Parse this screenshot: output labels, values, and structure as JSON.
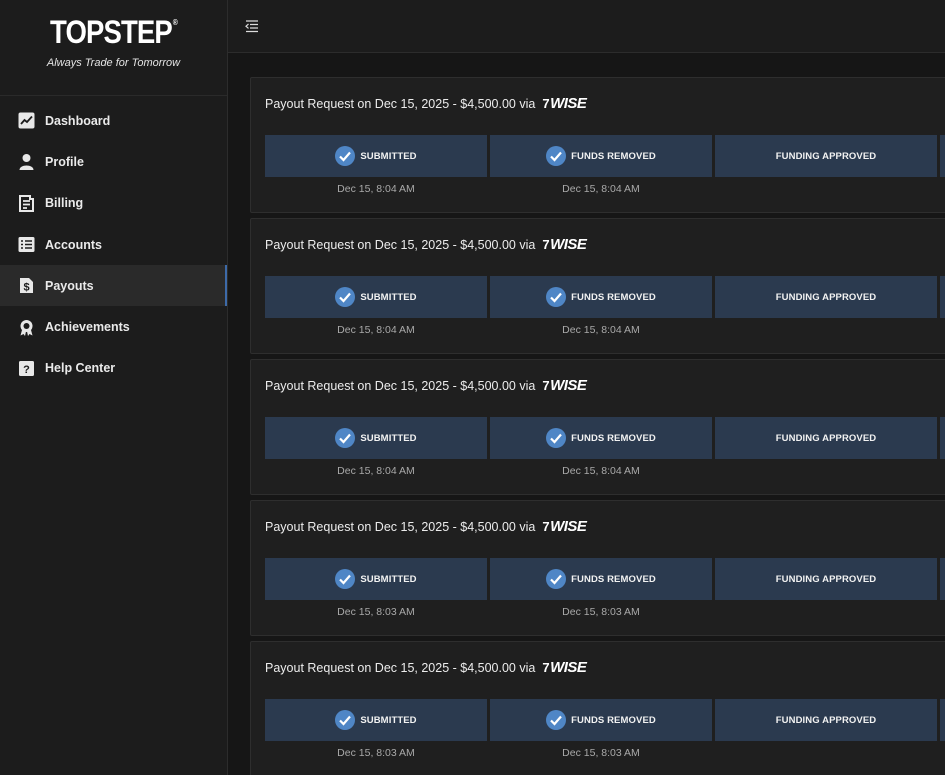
{
  "brand": {
    "logo": "TOPSTEP",
    "logo_mark": "®",
    "tagline": "Always Trade for Tomorrow"
  },
  "nav": [
    {
      "label": "Dashboard",
      "icon": "chart-icon"
    },
    {
      "label": "Profile",
      "icon": "user-icon"
    },
    {
      "label": "Billing",
      "icon": "billing-icon"
    },
    {
      "label": "Accounts",
      "icon": "list-icon"
    },
    {
      "label": "Payouts",
      "icon": "dollar-doc-icon",
      "active": true
    },
    {
      "label": "Achievements",
      "icon": "award-icon"
    },
    {
      "label": "Help Center",
      "icon": "question-icon"
    }
  ],
  "payouts": [
    {
      "title": "Payout Request on Dec 15, 2025 - $4,500.00 via",
      "method": "WISE",
      "method_flag": "7",
      "steps": [
        {
          "label": "SUBMITTED",
          "done": true,
          "time": "Dec 15, 8:04 AM"
        },
        {
          "label": "FUNDS REMOVED",
          "done": true,
          "time": "Dec 15, 8:04 AM"
        },
        {
          "label": "FUNDING APPROVED",
          "done": false,
          "time": ""
        }
      ]
    },
    {
      "title": "Payout Request on Dec 15, 2025 - $4,500.00 via",
      "method": "WISE",
      "method_flag": "7",
      "steps": [
        {
          "label": "SUBMITTED",
          "done": true,
          "time": "Dec 15, 8:04 AM"
        },
        {
          "label": "FUNDS REMOVED",
          "done": true,
          "time": "Dec 15, 8:04 AM"
        },
        {
          "label": "FUNDING APPROVED",
          "done": false,
          "time": ""
        }
      ]
    },
    {
      "title": "Payout Request on Dec 15, 2025 - $4,500.00 via",
      "method": "WISE",
      "method_flag": "7",
      "steps": [
        {
          "label": "SUBMITTED",
          "done": true,
          "time": "Dec 15, 8:04 AM"
        },
        {
          "label": "FUNDS REMOVED",
          "done": true,
          "time": "Dec 15, 8:04 AM"
        },
        {
          "label": "FUNDING APPROVED",
          "done": false,
          "time": ""
        }
      ]
    },
    {
      "title": "Payout Request on Dec 15, 2025 - $4,500.00 via",
      "method": "WISE",
      "method_flag": "7",
      "steps": [
        {
          "label": "SUBMITTED",
          "done": true,
          "time": "Dec 15, 8:03 AM"
        },
        {
          "label": "FUNDS REMOVED",
          "done": true,
          "time": "Dec 15, 8:03 AM"
        },
        {
          "label": "FUNDING APPROVED",
          "done": false,
          "time": ""
        }
      ]
    },
    {
      "title": "Payout Request on Dec 15, 2025 - $4,500.00 via",
      "method": "WISE",
      "method_flag": "7",
      "steps": [
        {
          "label": "SUBMITTED",
          "done": true,
          "time": "Dec 15, 8:03 AM"
        },
        {
          "label": "FUNDS REMOVED",
          "done": true,
          "time": "Dec 15, 8:03 AM"
        },
        {
          "label": "FUNDING APPROVED",
          "done": false,
          "time": ""
        }
      ]
    }
  ],
  "colors": {
    "step_bg": "#2b3a4f",
    "check": "#4f86c6",
    "active_border": "#3d6aa8"
  }
}
